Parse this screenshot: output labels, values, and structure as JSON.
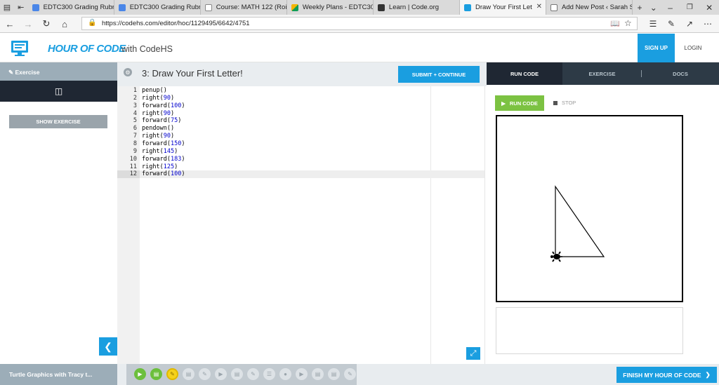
{
  "browser": {
    "tabs": [
      {
        "title": "EDTC300 Grading Rubr",
        "color": "#4a86e8"
      },
      {
        "title": "EDTC300 Grading Rubr",
        "color": "#4a86e8"
      },
      {
        "title": "Course: MATH 122 (Roi",
        "color": "#888888"
      },
      {
        "title": "Weekly Plans - EDTC30",
        "color": "#f4b400"
      },
      {
        "title": "Learn | Code.org",
        "color": "#333333"
      },
      {
        "title": "Draw Your First Let",
        "color": "#1a9ee0",
        "active": true
      },
      {
        "title": "Add New Post ‹ Sarah S",
        "color": "#777777"
      }
    ],
    "url": "https://codehs.com/editor/hoc/1129495/6642/4751"
  },
  "header": {
    "logo_title": "HOUR OF CODE",
    "logo_sub": "with CodeHS",
    "signup": "SIGN UP",
    "login": "LOGIN"
  },
  "sidebar": {
    "exercise_label": "Exercise",
    "show_exercise": "SHOW EXERCISE"
  },
  "editor": {
    "title": "3: Draw Your First Letter!",
    "submit": "SUBMIT + CONTINUE",
    "code": [
      {
        "fn": "penup",
        "arg": ""
      },
      {
        "fn": "right",
        "arg": "90"
      },
      {
        "fn": "forward",
        "arg": "100"
      },
      {
        "fn": "right",
        "arg": "90"
      },
      {
        "fn": "forward",
        "arg": "75"
      },
      {
        "fn": "pendown",
        "arg": ""
      },
      {
        "fn": "right",
        "arg": "90"
      },
      {
        "fn": "forward",
        "arg": "150"
      },
      {
        "fn": "right",
        "arg": "145"
      },
      {
        "fn": "forward",
        "arg": "183"
      },
      {
        "fn": "right",
        "arg": "125"
      },
      {
        "fn": "forward",
        "arg": "100"
      }
    ]
  },
  "right_panel": {
    "tabs": [
      "RUN CODE",
      "EXERCISE",
      "DOCS"
    ],
    "run": "RUN CODE",
    "stop": "STOP"
  },
  "bottom": {
    "lesson": "Turtle Graphics with Tracy t...",
    "finish": "FINISH MY HOUR OF CODE",
    "progress_icons": [
      {
        "icon": "video-icon",
        "state": "done",
        "color": "#6cbf3c"
      },
      {
        "icon": "document-icon",
        "state": "done",
        "color": "#6cbf3c"
      },
      {
        "icon": "pencil-icon",
        "state": "current",
        "color": "#f5d21c"
      },
      {
        "icon": "document-icon",
        "state": "todo",
        "color": "#dde2e6"
      },
      {
        "icon": "pencil-icon",
        "state": "todo",
        "color": "#dde2e6"
      },
      {
        "icon": "video-icon",
        "state": "todo",
        "color": "#dde2e6"
      },
      {
        "icon": "document-icon",
        "state": "todo",
        "color": "#dde2e6"
      },
      {
        "icon": "pencil-icon",
        "state": "todo",
        "color": "#dde2e6"
      },
      {
        "icon": "list-icon",
        "state": "todo",
        "color": "#dde2e6"
      },
      {
        "icon": "circle-icon",
        "state": "todo",
        "color": "#dde2e6"
      },
      {
        "icon": "video-icon",
        "state": "todo",
        "color": "#dde2e6"
      },
      {
        "icon": "document-icon",
        "state": "todo",
        "color": "#dde2e6"
      },
      {
        "icon": "document-icon",
        "state": "todo",
        "color": "#dde2e6"
      },
      {
        "icon": "pencil-icon",
        "state": "todo",
        "color": "#dde2e6"
      }
    ]
  },
  "colors": {
    "accent": "#1a9ee0",
    "run_green": "#7cc242",
    "dark_nav": "#1f2733"
  }
}
